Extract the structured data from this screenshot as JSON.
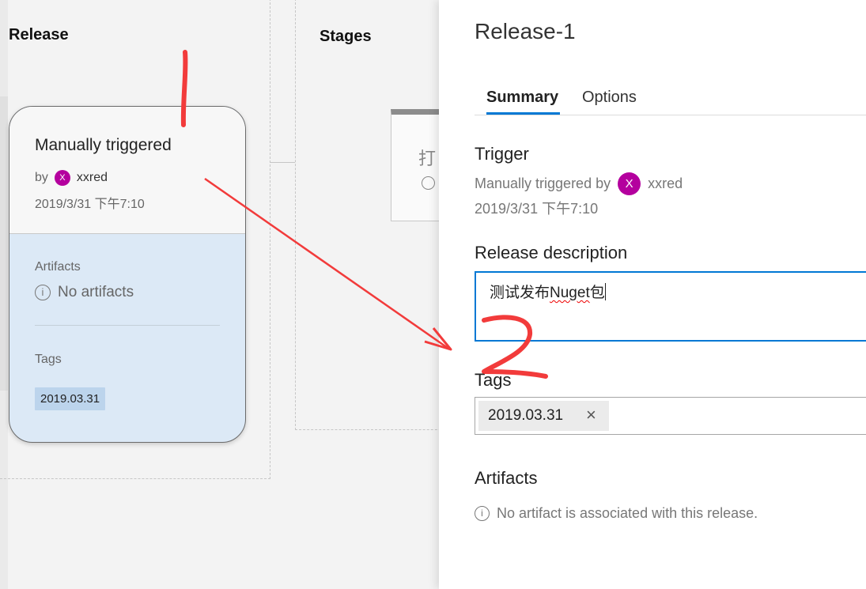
{
  "left": {
    "release_title": "Release",
    "stages_title": "Stages",
    "card": {
      "title": "Manually triggered",
      "by_label": "by",
      "avatar_letter": "X",
      "user": "xxred",
      "date": "2019/3/31 下午7:10",
      "artifacts_label": "Artifacts",
      "no_artifacts": "No artifacts",
      "tags_label": "Tags",
      "tag": "2019.03.31"
    },
    "stage_partial_text": "打"
  },
  "panel": {
    "title": "Release-1",
    "tabs": [
      {
        "label": "Summary",
        "active": true
      },
      {
        "label": "Options",
        "active": false
      }
    ],
    "trigger": {
      "heading": "Trigger",
      "text": "Manually triggered by",
      "avatar_letter": "X",
      "user": "xxred",
      "date": "2019/3/31 下午7:10"
    },
    "description": {
      "heading": "Release description",
      "value_prefix": "测试发布",
      "value_underlined": "Nuget",
      "value_suffix": "包"
    },
    "tags": {
      "heading": "Tags",
      "items": [
        "2019.03.31"
      ],
      "remove_icon": "×"
    },
    "artifacts": {
      "heading": "Artifacts",
      "empty_text": "No artifact is associated with this release."
    }
  },
  "annotations": {
    "mark_1": "1",
    "mark_2": "2",
    "color": "#f23b3b"
  },
  "colors": {
    "accent": "#0078d4",
    "avatar": "#b4009e",
    "card_bottom": "#dce9f6",
    "tag_chip": "#bcd4ec"
  }
}
